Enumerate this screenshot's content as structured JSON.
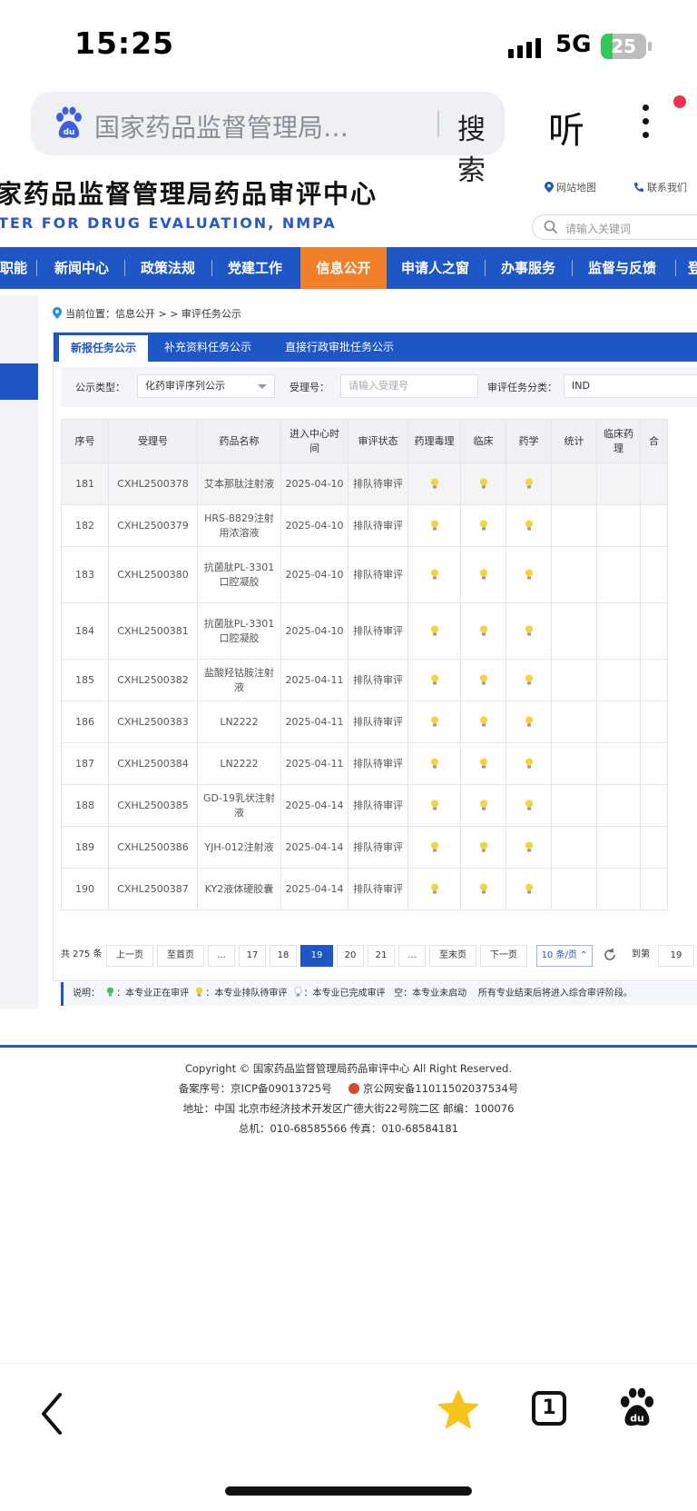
{
  "status_bar": {
    "time": "15:25",
    "network": "5G",
    "battery": "25",
    "battery_level": 0.25
  },
  "browser": {
    "search_text": "国家药品监督管理局…",
    "search_button": "搜索",
    "listen_button": "听"
  },
  "site": {
    "title": "家药品监督管理局药品审评中心",
    "subtitle": "TER FOR DRUG EVALUATION, NMPA",
    "links": {
      "sitemap": "网站地图",
      "contact": "联系我们"
    },
    "search_placeholder": "请输入关键词",
    "nav": [
      "职能",
      "新闻中心",
      "政策法规",
      "党建工作",
      "信息公开",
      "申请人之窗",
      "办事服务",
      "监督与反馈",
      "登"
    ],
    "active_nav": "信息公开",
    "breadcrumb": "当前位置：信息公开 > > 审评任务公示",
    "tabs": [
      "新报任务公示",
      "补充资料任务公示",
      "直接行政审批任务公示"
    ],
    "filters": {
      "type_label": "公示类型：",
      "type_value": "化药审评序列公示",
      "accept_label": "受理号：",
      "accept_placeholder": "请输入受理号",
      "category_label": "审评任务分类：",
      "category_value": "IND"
    },
    "table": {
      "headers": [
        "序号",
        "受理号",
        "药品名称",
        "进入中心时间",
        "审评状态",
        "药理毒理",
        "临床",
        "药学",
        "统计",
        "临床药理",
        "合"
      ],
      "rows": [
        {
          "no": "181",
          "id": "CXHL2500378",
          "name": "艾本那肽注射液",
          "date": "2025-04-10",
          "status": "排队待审评"
        },
        {
          "no": "182",
          "id": "CXHL2500379",
          "name": "HRS-8829注射用浓溶液",
          "date": "2025-04-10",
          "status": "排队待审评"
        },
        {
          "no": "183",
          "id": "CXHL2500380",
          "name": "抗菌肽PL-3301口腔凝胶",
          "date": "2025-04-10",
          "status": "排队待审评"
        },
        {
          "no": "184",
          "id": "CXHL2500381",
          "name": "抗菌肽PL-3301口腔凝胶",
          "date": "2025-04-10",
          "status": "排队待审评"
        },
        {
          "no": "185",
          "id": "CXHL2500382",
          "name": "盐酸羟钴胺注射液",
          "date": "2025-04-11",
          "status": "排队待审评"
        },
        {
          "no": "186",
          "id": "CXHL2500383",
          "name": "LN2222",
          "date": "2025-04-11",
          "status": "排队待审评"
        },
        {
          "no": "187",
          "id": "CXHL2500384",
          "name": "LN2222",
          "date": "2025-04-11",
          "status": "排队待审评"
        },
        {
          "no": "188",
          "id": "CXHL2500385",
          "name": "GD-19乳状注射液",
          "date": "2025-04-14",
          "status": "排队待审评"
        },
        {
          "no": "189",
          "id": "CXHL2500386",
          "name": "YJH-012注射液",
          "date": "2025-04-14",
          "status": "排队待审评"
        },
        {
          "no": "190",
          "id": "CXHL2500387",
          "name": "KY2液体硬胶囊",
          "date": "2025-04-14",
          "status": "排队待审评"
        }
      ]
    },
    "pager": {
      "total": "共 275 条",
      "prev": "上一页",
      "first": "至首页",
      "ellipsis": "...",
      "pages": [
        "17",
        "18",
        "19",
        "20",
        "21"
      ],
      "current": "19",
      "last": "至末页",
      "next": "下一页",
      "page_size": "10 条/页",
      "goto_label": "到第",
      "goto_value": "19"
    },
    "legend": {
      "prefix": "说明：",
      "green": "：本专业正在审评",
      "yellow": "：本专业排队待审评",
      "white": "：本专业已完成审评",
      "empty": "空：本专业未启动",
      "note": "所有专业结束后将进入综合审评阶段。"
    },
    "footer": {
      "copyright": "Copyright © 国家药品监督管理局药品审评中心    All Right Reserved.",
      "icp": "备案序号：京ICP备09013725号",
      "police": "京公网安备11011502037534号",
      "address": "地址：中国 北京市经济技术开发区广德大街22号院二区      邮编：100076",
      "phone": "总机：010-68585566      传真：010-68584181"
    }
  },
  "bottom_bar": {
    "tab_count": "1"
  },
  "colors": {
    "nav_blue": "#1f56c6",
    "active_orange": "#f0812a",
    "bulb_yellow": "#f5d33a"
  }
}
